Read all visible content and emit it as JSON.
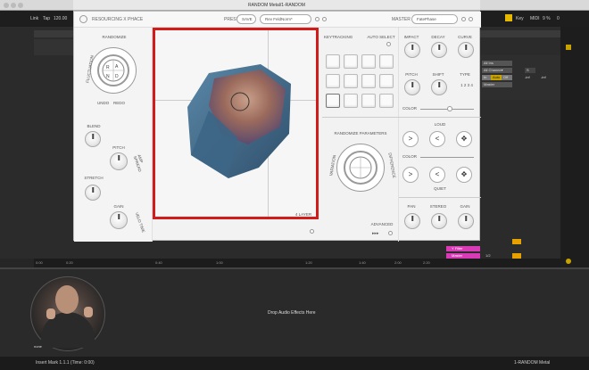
{
  "mac_window": {
    "title": "RANDOM Metal/1-RANDOM"
  },
  "daw": {
    "top": {
      "link": "Link",
      "tap": "Tap",
      "bpm": "120.00",
      "key": "Key",
      "midi": "MIDI",
      "cpu": "9 %",
      "zero": "0"
    },
    "timeline": [
      "0:00",
      "0:20",
      "0:40",
      "1:00",
      "1:20",
      "1:40",
      "2:00",
      "2:20"
    ],
    "right_panel": {
      "all_ins": "All Ins",
      "all_channels": "All Channe▾",
      "in": "In",
      "auto": "Auto",
      "off": "Off",
      "master": "Master",
      "inf1": "-inf",
      "inf2": "-inf",
      "val_s": "S",
      "num1": "2",
      "num2": "1/2"
    },
    "lower_tracks": [
      {
        "label": "Y Filter"
      },
      {
        "label": "Master"
      }
    ],
    "drop_message": "Drop Audio Effects Here",
    "status_left": "Insert Mark 1.1.1 (Time: 0:00)",
    "status_right": "1-RANDOM Metal",
    "webcam_label": "none"
  },
  "plugin": {
    "brand": "RESOURCING X PHACE",
    "preset_label": "PRESET",
    "save_label": "SAVE",
    "preset_value": "Rev FeldNorm*",
    "master_label": "MASTER",
    "master_value": "FatePhase",
    "randomize_label": "RANDOMIZE",
    "undo_label": "UNDO",
    "redo_label": "REDO",
    "blend_label": "BLEND",
    "pitch_label": "PITCH",
    "stretch_label": "STRETCH",
    "gain_label": "GAIN",
    "keytracking_label": "KEYTRACKING",
    "autoselect_label": "AUTO SELECT",
    "impact_label": "IMPACT",
    "decay_label": "DECAY",
    "curve_label": "CURVE",
    "pitch2_label": "PITCH",
    "shift_label": "SHIFT",
    "type_label": "TYPE",
    "type_values": "1 2 3 4",
    "color_label": "COLOR",
    "randomize_params_label": "RANDOMIZE PARAMETERS",
    "loud_label": "LOUD",
    "color2_label": "COLOR",
    "quiet_label": "QUIET",
    "pan_label": "PAN",
    "stereo_label": "STEREO",
    "gain2_label": "GAIN",
    "advanced_label": "ADVANCED",
    "layer_label": "4 LAYER",
    "side_left": "FLUCTUATION",
    "side_right": "SIMILARITY",
    "side_left2": "VARIATION",
    "side_right2": "DIFFERENCE",
    "amp_text": "AMP SPREAD",
    "vel_text": "VELO TIME"
  }
}
